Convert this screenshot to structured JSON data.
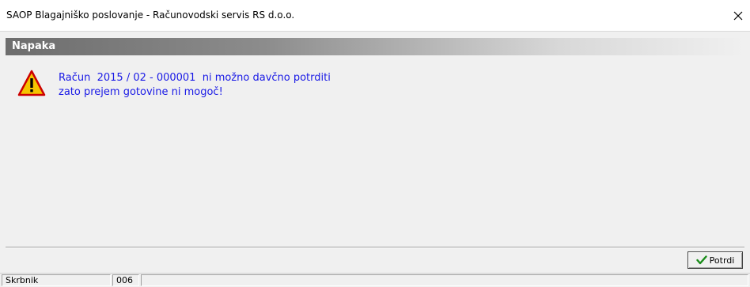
{
  "window": {
    "title": "SAOP Blagajniško poslovanje - Računovodski servis RS d.o.o."
  },
  "dialog": {
    "header": "Napaka",
    "message_line1": "Račun  2015 / 02 - 000001  ni možno davčno potrditi",
    "message_line2": "zato prejem gotovine ni mogoč!",
    "icon": "warning-icon",
    "confirm_label": "Potrdi"
  },
  "statusbar": {
    "user": "Skrbnik",
    "code": "006",
    "extra": ""
  },
  "colors": {
    "message_text": "#1a1ae6",
    "header_bg": "#6d6d6d",
    "warning_fill": "#f5c400",
    "warning_outline": "#cc0000",
    "check_green": "#1a8c1a"
  }
}
